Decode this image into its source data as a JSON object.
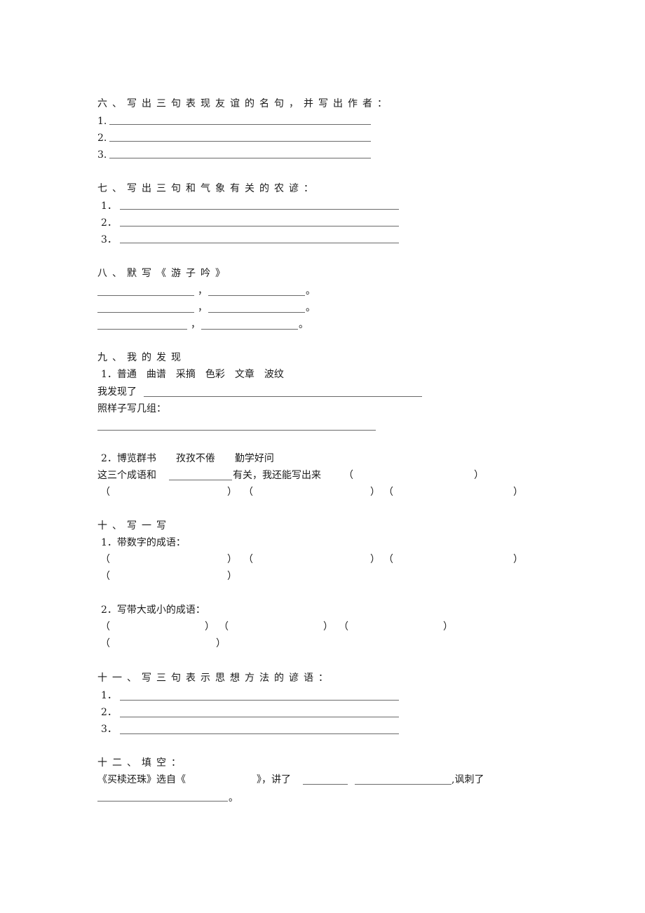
{
  "sections": {
    "s6": {
      "title": "六、写出三句表现友谊的名句，并写出作者：",
      "items": [
        "1.",
        "2.",
        "3."
      ]
    },
    "s7": {
      "title": "七、写出三句和气象有关的农谚：",
      "items": [
        "1．",
        "2．",
        "3．"
      ]
    },
    "s8": {
      "title": "八、默写《游子吟》",
      "comma": "，",
      "period": "。"
    },
    "s9": {
      "title": "九、我的发现",
      "q1_words": "1．普通　曲谱　采摘　色彩　文章　波纹",
      "q1_found": "我发现了",
      "q1_examples": "照样子写几组：",
      "q2_words": "2．博览群书　　孜孜不倦　　勤学好问",
      "q2_prompt_a": "这三个成语和",
      "q2_prompt_b": "有关，我还能写出来",
      "open_paren": "（",
      "close_paren": "）"
    },
    "s10": {
      "title": "十、写一写",
      "q1": "1．带数字的成语：",
      "q2": "2．写带大或小的成语：",
      "open_paren": "（",
      "close_paren": "）"
    },
    "s11": {
      "title": "十一、写三句表示思想方法的谚语：",
      "items": [
        "1．",
        "2．",
        "3．"
      ]
    },
    "s12": {
      "title": "十二、填空：",
      "text_a": "《买椟还珠》选自《",
      "text_b": "》，讲了",
      "text_c": ",讽刺了",
      "period": "。"
    }
  }
}
